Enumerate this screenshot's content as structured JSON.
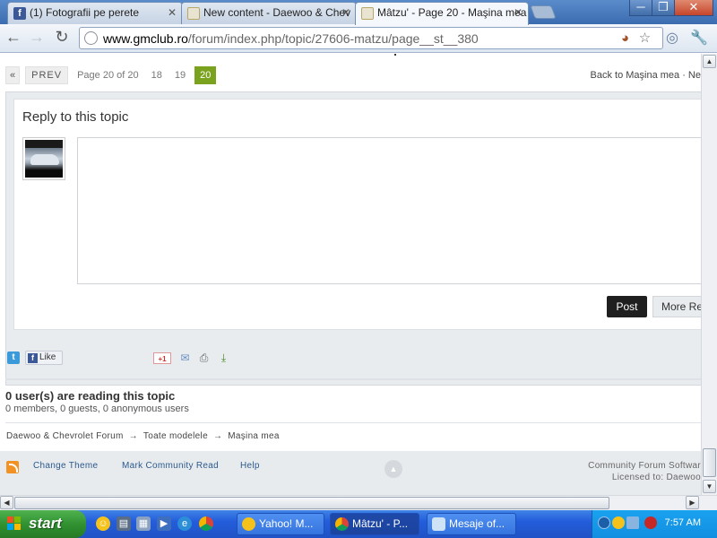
{
  "browser": {
    "tabs": [
      {
        "label": "(1) Fotografii pe perete",
        "icon": "facebook-favicon",
        "active": false
      },
      {
        "label": "New content - Daewoo & Chev",
        "icon": "gmclub-favicon",
        "active": false
      },
      {
        "label": "Mâtzu' - Page 20 - Maşina mea",
        "icon": "gmclub-favicon",
        "active": true
      }
    ],
    "url_domain": "www.gmclub.ro",
    "url_path": "/forum/index.php/topic/27606-matzu/page__st__380",
    "window_controls": [
      "─",
      "❐",
      "✕"
    ]
  },
  "pager": {
    "first": "«",
    "prev": "PREV",
    "page_info": "Page 20 of 20",
    "pages": [
      "18",
      "19"
    ],
    "current": "20",
    "back_link": "Back to Maşina mea · Ne"
  },
  "reply": {
    "title": "Reply to this topic",
    "post_button": "Post",
    "more_button": "More Re"
  },
  "share": {
    "like_label": "Like",
    "gplus_label": "+1"
  },
  "readers": {
    "title": "0 user(s) are reading this topic",
    "subtitle": "0 members, 0 guests, 0 anonymous users"
  },
  "breadcrumb": {
    "items": [
      "Daewoo & Chevrolet Forum",
      "Toate modelele",
      "Maşina mea"
    ],
    "separator": "→"
  },
  "footer": {
    "links": [
      "Change Theme",
      "Mark Community Read",
      "Help"
    ],
    "copyright_line1": "Community Forum Softwar",
    "copyright_line2": "Licensed to: Daewoo"
  },
  "taskbar": {
    "start_label": "start",
    "tasks": [
      {
        "label": "Yahoo! M...",
        "active": false
      },
      {
        "label": "Mâtzu' - P...",
        "active": true
      },
      {
        "label": "Mesaje of...",
        "active": false
      }
    ],
    "clock": "7:57 AM"
  },
  "colors": {
    "current_page": "#7ba21f",
    "link": "#2c5a8c",
    "post_button": "#1f1f1f",
    "taskbar": "#245ddb",
    "start_button": "#2f8f2f"
  }
}
